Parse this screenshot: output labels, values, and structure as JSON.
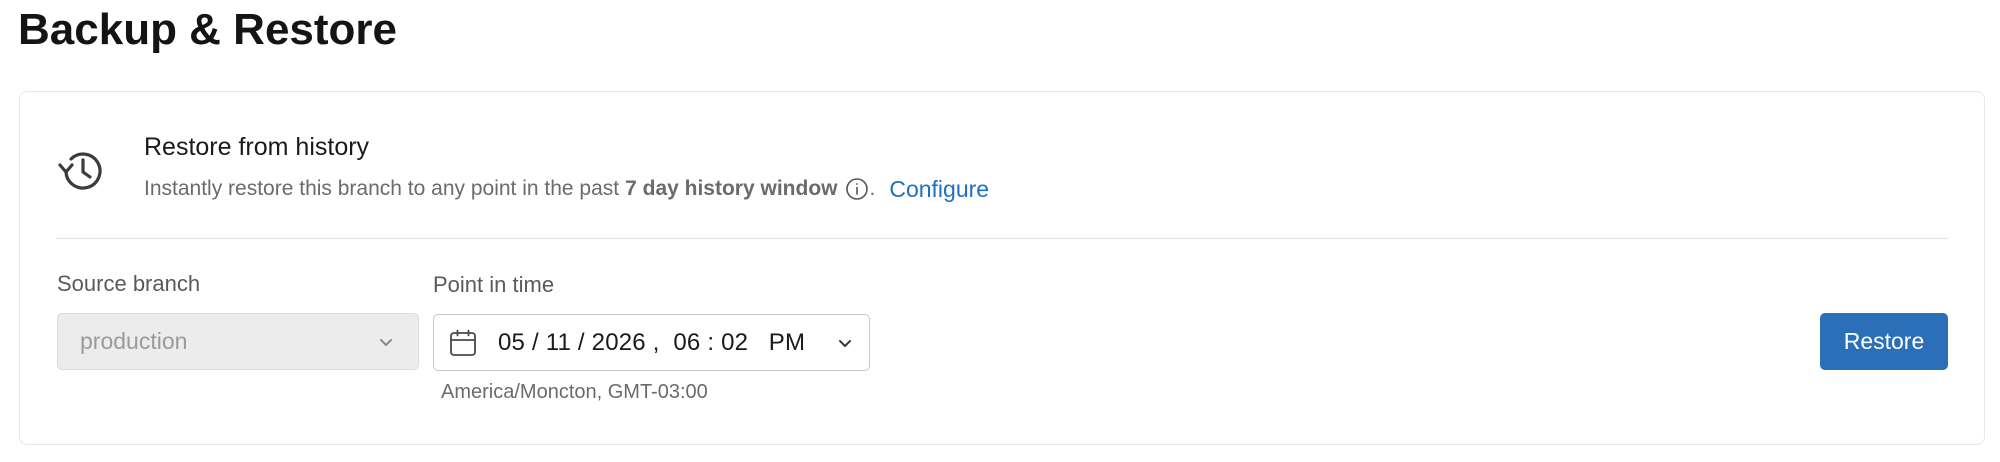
{
  "page": {
    "title": "Backup & Restore"
  },
  "restore_card": {
    "icon": "history-icon",
    "title": "Restore from history",
    "description_prefix": "Instantly restore this branch to any point in the past",
    "description_bold": "7 day history window",
    "info_icon": "info-icon",
    "description_suffix": ".",
    "configure_label": "Configure"
  },
  "form": {
    "source_branch_label": "Source branch",
    "source_branch_value": "production",
    "point_in_time_label": "Point in time",
    "date_month": "05",
    "date_day": "11",
    "date_year": "2026",
    "time_hour": "06",
    "time_minute": "02",
    "time_period": "PM",
    "timezone_note": "America/Moncton, GMT-03:00",
    "restore_label": "Restore"
  },
  "colors": {
    "accent": "#2b6fb9",
    "link": "#1f6fc1",
    "disabled_bg": "#ececec"
  }
}
